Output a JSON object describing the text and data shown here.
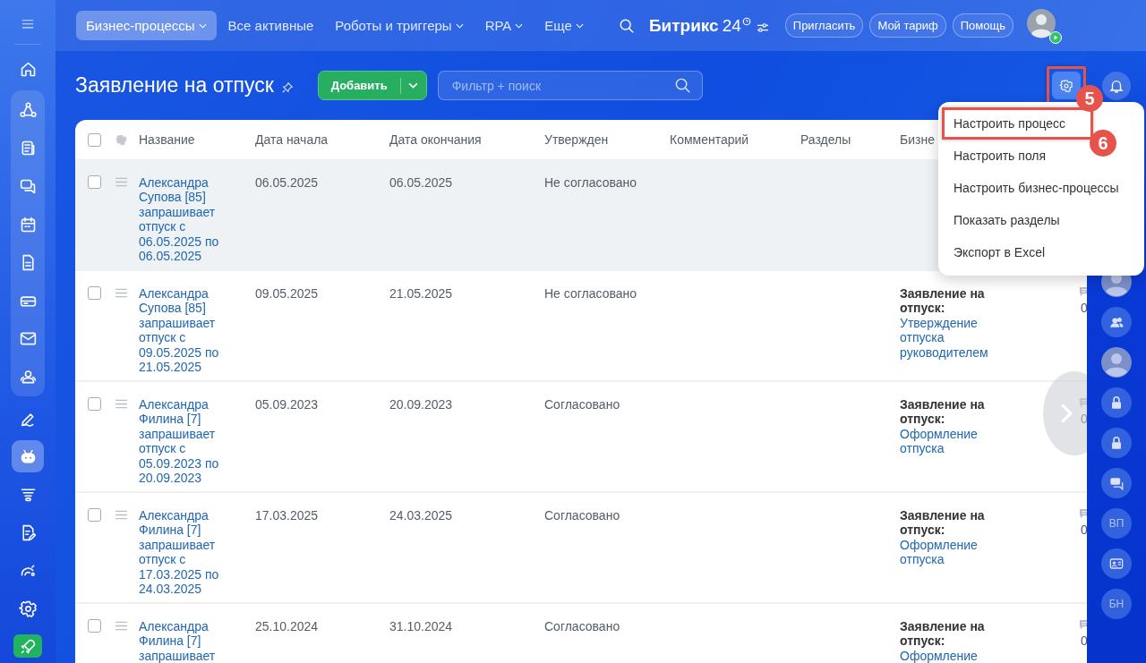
{
  "sidebar": {
    "sections": [
      {
        "boxed": false,
        "items": [
          {
            "kind": "home",
            "selected": false
          }
        ]
      },
      {
        "boxed": true,
        "items": [
          {
            "kind": "flow",
            "selected": false
          },
          {
            "kind": "news",
            "selected": false
          },
          {
            "kind": "chat",
            "selected": false
          },
          {
            "kind": "calendar",
            "selected": false
          },
          {
            "kind": "doc",
            "selected": false
          },
          {
            "kind": "drive",
            "selected": false
          },
          {
            "kind": "mail",
            "selected": false
          },
          {
            "kind": "contacts",
            "selected": false
          }
        ]
      },
      {
        "boxed": false,
        "items": [
          {
            "kind": "pen",
            "selected": false
          },
          {
            "kind": "robot",
            "selected": true
          },
          {
            "kind": "funnel",
            "selected": false
          },
          {
            "kind": "docedit",
            "selected": false
          },
          {
            "kind": "gauge",
            "selected": false
          },
          {
            "kind": "gear",
            "selected": false
          },
          {
            "kind": "rocket",
            "selected": false
          }
        ]
      }
    ]
  },
  "top_nav": {
    "tabs": [
      {
        "label": "Бизнес-процессы",
        "dropdown": true,
        "selected": true
      },
      {
        "label": "Все активные",
        "dropdown": false,
        "selected": false
      },
      {
        "label": "Роботы и триггеры",
        "dropdown": true,
        "selected": false
      },
      {
        "label": "RPA",
        "dropdown": true,
        "selected": false
      },
      {
        "label": "Еще",
        "dropdown": true,
        "selected": false
      }
    ],
    "logo": {
      "name": "Битрикс",
      "number": "24"
    },
    "buttons": [
      "Пригласить",
      "Мой тариф",
      "Помощь"
    ]
  },
  "page": {
    "title": "Заявление на отпуск",
    "add_button": "Добавить",
    "filter": {
      "placeholder": "Фильтр + поиск"
    },
    "settings_button": {
      "callout": "5"
    }
  },
  "settings_menu": {
    "items": [
      {
        "label": "Настроить процесс",
        "callout": "6"
      },
      {
        "label": "Настроить поля"
      },
      {
        "label": "Настроить бизнес-процессы"
      },
      {
        "label": "Показать разделы"
      },
      {
        "label": "Экспорт в Excel"
      }
    ]
  },
  "table": {
    "header_checkbox": {
      "checked": false
    },
    "columns": [
      "Название",
      "Дата начала",
      "Дата окончания",
      "Утвержден",
      "Комментарий",
      "Разделы",
      "Бизне"
    ],
    "rows": [
      {
        "highlighted": true,
        "checked": false,
        "name": "Александра Супова [85] запрашивает отпуск с 06.05.2025 по 06.05.2025",
        "start": "06.05.2025",
        "end": "06.05.2025",
        "approved": "Не согласовано"
      },
      {
        "highlighted": false,
        "checked": false,
        "name": "Александра Супова [85] запрашивает отпуск с 09.05.2025 по 21.05.2025",
        "start": "09.05.2025",
        "end": "21.05.2025",
        "approved": "Не согласовано",
        "bp_title": "Заявление на отпуск:",
        "bp_stage": "Утверждение отпуска руководителем",
        "comments": "0"
      },
      {
        "highlighted": false,
        "checked": false,
        "name": "Александра Филина [7] запрашивает отпуск с 05.09.2023 по 20.09.2023",
        "start": "05.09.2023",
        "end": "20.09.2023",
        "approved": "Согласовано",
        "bp_title": "Заявление на отпуск:",
        "bp_stage": "Оформление отпуска",
        "comments": "0"
      },
      {
        "highlighted": false,
        "checked": false,
        "name": "Александра Филина [7] запрашивает отпуск с 17.03.2025 по 24.03.2025",
        "start": "17.03.2025",
        "end": "24.03.2025",
        "approved": "Согласовано",
        "bp_title": "Заявление на отпуск:",
        "bp_stage": "Оформление отпуска",
        "comments": "0"
      },
      {
        "highlighted": false,
        "checked": false,
        "name": "Александра Филина [7] запрашивает",
        "start": "25.10.2024",
        "end": "31.10.2024",
        "approved": "Согласовано",
        "bp_title": "Заявление на отпуск:",
        "bp_stage": "Оформление",
        "comments": "0"
      }
    ]
  },
  "right_panel": {
    "items": [
      {
        "kind": "avatar"
      },
      {
        "kind": "group"
      },
      {
        "kind": "avatar"
      },
      {
        "kind": "lock"
      },
      {
        "kind": "lock"
      },
      {
        "kind": "chat"
      },
      {
        "kind": "initials",
        "text": "ВП"
      },
      {
        "kind": "card"
      },
      {
        "kind": "initials",
        "text": "БН"
      }
    ]
  }
}
